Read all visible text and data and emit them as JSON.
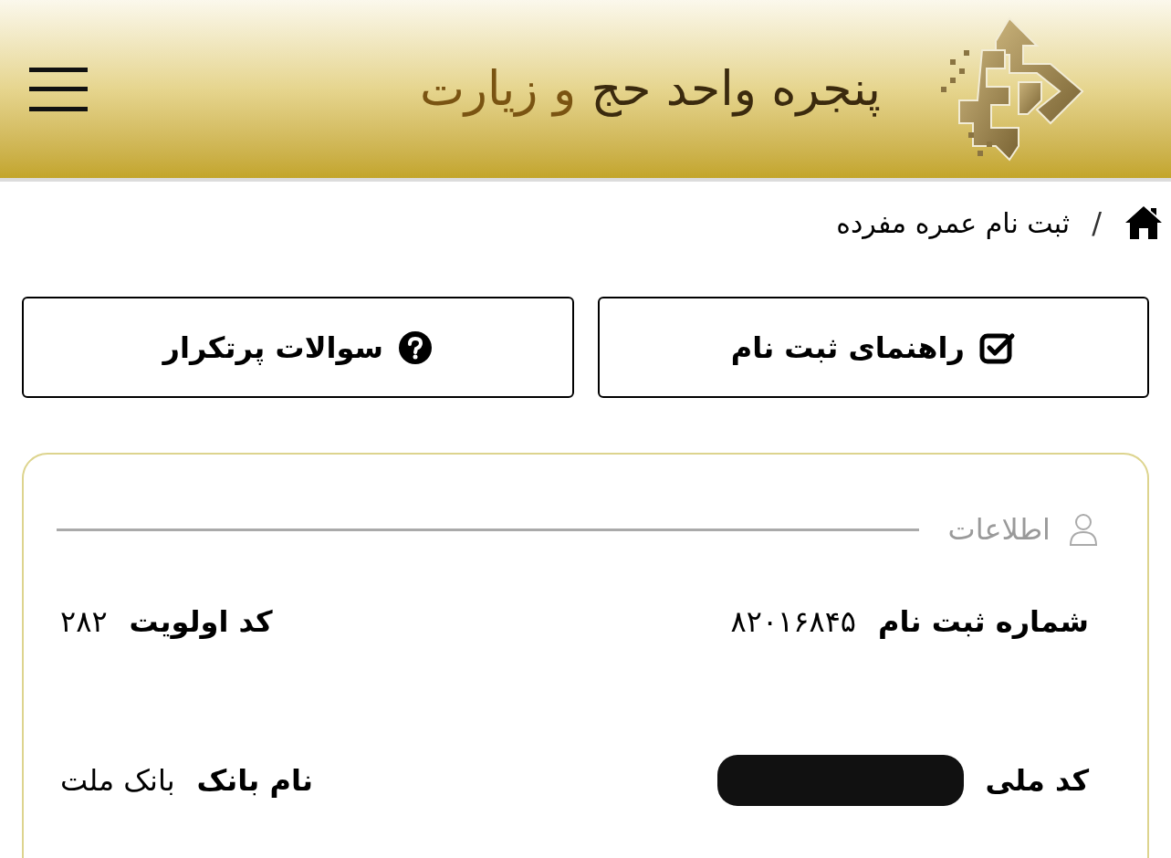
{
  "header": {
    "title_parts": [
      {
        "text": "پنجره واحد حج",
        "accent": false
      },
      {
        "text": "و زیارت",
        "accent": true
      }
    ]
  },
  "breadcrumb": {
    "separator": "/",
    "current": "ثبت نام عمره مفرده"
  },
  "actions": [
    {
      "label": "راهنمای ثبت نام",
      "kind": "guide"
    },
    {
      "label": "سوالات پرتکرار",
      "kind": "faq"
    }
  ],
  "info": {
    "legend": "اطلاعات",
    "fields": [
      {
        "label": "شماره ثبت نام",
        "value": "۸۲۰۱۶۸۴۵",
        "redacted": false
      },
      {
        "label": "کد اولویت",
        "value": "۲۸۲",
        "redacted": false
      },
      {
        "label": "کد ملی",
        "redacted": true
      },
      {
        "label": "نام بانک",
        "value": "بانک ملت",
        "redacted": false
      }
    ]
  }
}
